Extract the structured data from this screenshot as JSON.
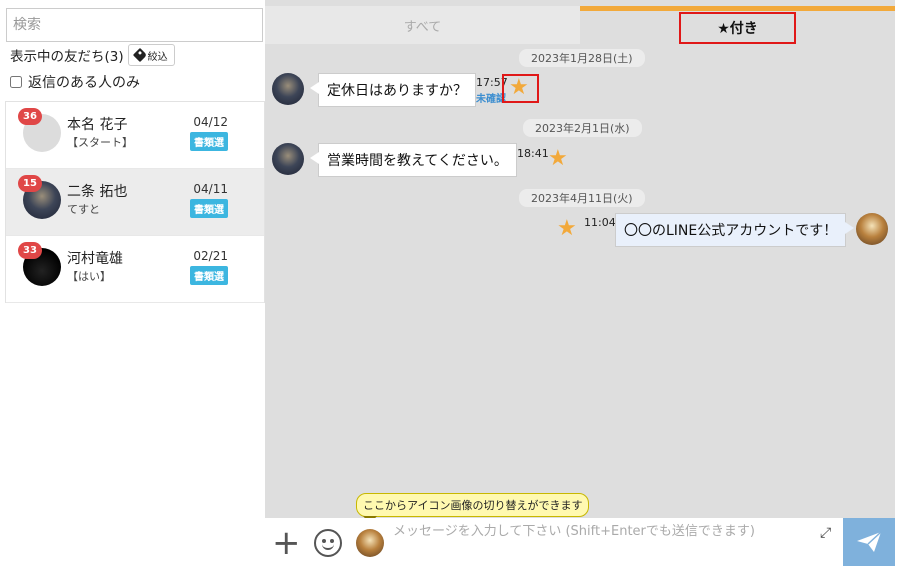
{
  "sidebar": {
    "search_placeholder": "検索",
    "friend_count_label": "表示中の友だち(3)",
    "filter_label": "絞込",
    "reply_only_label": "返信のある人のみ",
    "friends": [
      {
        "badge": "36",
        "name": "本名 花子",
        "sub": "【スタート】",
        "date": "04/12",
        "status": "書類選",
        "avatar": "blank-avatar"
      },
      {
        "badge": "15",
        "name": "二条 拓也",
        "sub": "てすと",
        "date": "04/11",
        "status": "書類選",
        "avatar": "photo-avatar"
      },
      {
        "badge": "33",
        "name": "河村竜雄",
        "sub": "【はい】",
        "date": "02/21",
        "status": "書類選",
        "avatar": "dark-avatar"
      }
    ]
  },
  "tabs": {
    "all": "すべて",
    "starred": "★付き"
  },
  "messages": {
    "date1": "2023年1月28日(土)",
    "msg1": "定休日はありますか？",
    "time1": "17:57",
    "unread1": "未確認",
    "date2": "2023年2月1日(水)",
    "msg2": "営業時間を教えてください。",
    "time2": "18:41",
    "date3": "2023年4月11日(火)",
    "msg3": "〇〇のLINE公式アカウントです！",
    "time3": "11:04",
    "star_glyph": "★"
  },
  "input_bar": {
    "plus": "+",
    "placeholder": "メッセージを入力して下さい (Shift+Enterでも送信できます)",
    "tooltip": "ここからアイコン画像の切り替えができます",
    "expand_glyph": "⤢"
  },
  "colors": {
    "accent_tab": "#f2a93b",
    "highlight": "#e01818",
    "badge": "#e04747",
    "status": "#3cb6e0",
    "send": "#7fb1dc"
  }
}
